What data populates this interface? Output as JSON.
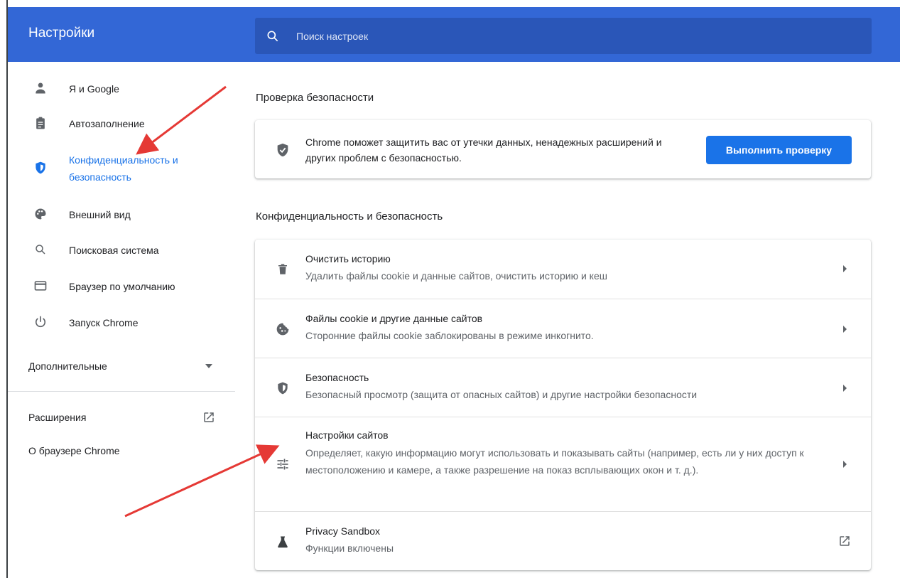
{
  "header": {
    "title": "Настройки",
    "search_placeholder": "Поиск настроек"
  },
  "sidebar": {
    "items": [
      {
        "label": "Я и Google",
        "icon": "person-icon"
      },
      {
        "label": "Автозаполнение",
        "icon": "clipboard-icon"
      },
      {
        "label": "Конфиденциальность и безопасность",
        "icon": "shield-icon",
        "active": true
      },
      {
        "label": "Внешний вид",
        "icon": "palette-icon"
      },
      {
        "label": "Поисковая система",
        "icon": "search-icon"
      },
      {
        "label": "Браузер по умолчанию",
        "icon": "browser-icon"
      },
      {
        "label": "Запуск Chrome",
        "icon": "power-icon"
      }
    ],
    "advanced_label": "Дополнительные",
    "extensions_label": "Расширения",
    "about_label": "О браузере Chrome"
  },
  "safety_check": {
    "title": "Проверка безопасности",
    "description": "Chrome поможет защитить вас от утечки данных, ненадежных расширений и других проблем с безопасностью.",
    "button_label": "Выполнить проверку"
  },
  "privacy": {
    "title": "Конфиденциальность и безопасность",
    "rows": [
      {
        "title": "Очистить историю",
        "subtitle": "Удалить файлы cookie и данные сайтов, очистить историю и кеш",
        "icon": "trash-icon"
      },
      {
        "title": "Файлы cookie и другие данные сайтов",
        "subtitle": "Сторонние файлы cookie заблокированы в режиме инкогнито.",
        "icon": "cookie-icon"
      },
      {
        "title": "Безопасность",
        "subtitle": "Безопасный просмотр (защита от опасных сайтов) и другие настройки безопасности",
        "icon": "shield-icon"
      },
      {
        "title": "Настройки сайтов",
        "subtitle": "Определяет, какую информацию могут использовать и показывать сайты (например, есть ли у них доступ к местоположению и камере, а также разрешение на показ всплывающих окон и т. д.).",
        "icon": "tune-icon"
      },
      {
        "title": "Privacy Sandbox",
        "subtitle": "Функции включены",
        "icon": "flask-icon"
      }
    ]
  },
  "colors": {
    "header_bg": "#3367d6",
    "accent": "#1a73e8",
    "annotation_arrow": "#e53935"
  }
}
